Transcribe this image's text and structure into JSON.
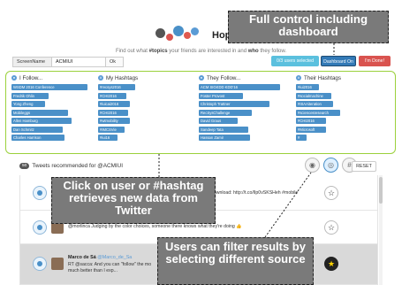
{
  "app": {
    "name": "HopTopics",
    "tagline_pre": "Find out what ",
    "tagline_b1": "#topics",
    "tagline_mid": " your friends are interested in and ",
    "tagline_b2": "who",
    "tagline_post": " they follow."
  },
  "form": {
    "label": "ScreenName",
    "value": "ACMIUI",
    "ok_label": "Ok"
  },
  "toolbar": {
    "users_selected": "0/3 users selected",
    "dashboard": "Dashboard On",
    "done": "I'm Done!"
  },
  "columns": [
    {
      "title": "I Follow...",
      "icon": "user-icon",
      "items": [
        "WSDM 2016 Conference",
        "Fredrik Ohlin",
        "Yong Zheng",
        "Mobileggs",
        "Allen Hamburg",
        "Dan Schmitz",
        "Charles Harrison"
      ]
    },
    {
      "title": "My Hashtags",
      "icon": "hashtag-icon",
      "items": [
        "#recsys2016",
        "#CHI2016",
        "#iuicai2016",
        "#CHI2016",
        "#wtmobility",
        "#IMCSVie",
        "#iui16"
      ]
    },
    {
      "title": "They Follow...",
      "icon": "user-icon",
      "items": [
        "ACM SIGKDD KDD'16",
        "Foster Provost",
        "Christoph Trattner",
        "RecSysChallenge",
        "David Graus",
        "Sandeep Tata",
        "Hassan Zamir"
      ]
    },
    {
      "title": "Their Hashtags",
      "icon": "hashtag-icon",
      "items": [
        "#iui2016",
        "#socialmachine",
        "#ISAAiteration",
        "#sciencesresearch",
        "#CHI2016",
        "#Microsoft",
        "#"
      ]
    }
  ],
  "tweets_header": {
    "count": "50",
    "label": "Tweets recommended for @ACMIUI",
    "reset": "RESET"
  },
  "filters": [
    {
      "icon": "person-source-icon",
      "active": false
    },
    {
      "icon": "mixed-source-icon",
      "active": true
    },
    {
      "icon": "hashtag-source-icon",
      "active": false
    }
  ],
  "tweets": [
    {
      "name": "",
      "handle": "",
      "text": "vide download: http://t.co/lIp0vSKSHeh #mobile",
      "starred": false
    },
    {
      "name": "",
      "handle": "",
      "text": "@morlinca Judging by the color choices, someone there knows what they're doing 👍",
      "starred": false
    },
    {
      "name": "Marco de Sá",
      "handle": "@Marco_de_Sa",
      "text": "RT @sacca: And you can \"follow\" the mo",
      "text2": "much better than I exp...",
      "text_right": "ing, So",
      "starred": true
    }
  ],
  "callouts": {
    "full_control": "Full control including dashboard",
    "click_user": "Click on user or #hashtag retrieves new data from Twitter",
    "filter": "Users can filter results by selecting different source"
  },
  "colors": {
    "accent": "#4a90c8",
    "panel_border": "#9bd13c",
    "callout_bg": "#7a7a7a",
    "done": "#d9534f",
    "dashboard": "#337ab7",
    "users": "#5bc0de"
  }
}
